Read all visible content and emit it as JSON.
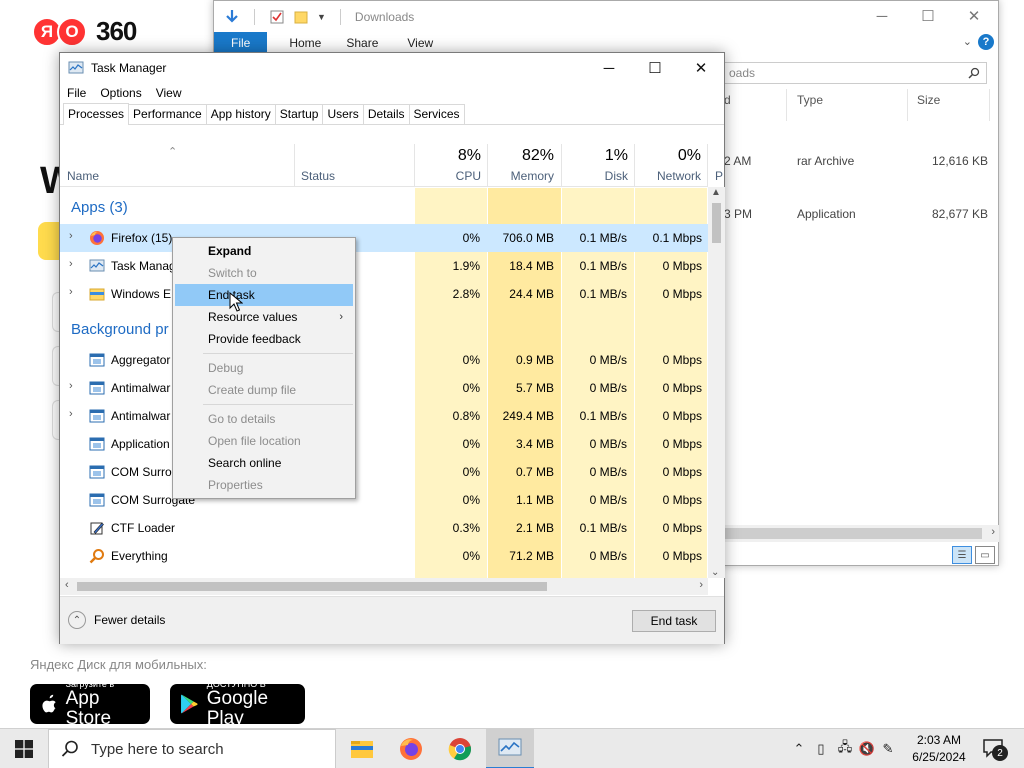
{
  "background_page": {
    "logo_letters": [
      "Я",
      "O"
    ],
    "logo_number": "360",
    "heading_fragment": "W",
    "mobile_label": "Яндекс Диск для мобильных:",
    "app_store": {
      "small": "Загрузите в",
      "big": "App Store"
    },
    "google_play": {
      "small": "ДОСТУПНО В",
      "big": "Google Play"
    }
  },
  "explorer": {
    "title": "Downloads",
    "ribbon_tabs": [
      "File",
      "Home",
      "Share",
      "View"
    ],
    "help_label": "?",
    "search_placeholder": "oads",
    "columns": [
      "d",
      "Type",
      "Size"
    ],
    "rows": [
      {
        "date": "2 AM",
        "type": "rar Archive",
        "size": "12,616 KB"
      },
      {
        "date": "3 PM",
        "type": "Application",
        "size": "82,677 KB"
      }
    ]
  },
  "task_manager": {
    "title": "Task Manager",
    "menu": [
      "File",
      "Options",
      "View"
    ],
    "tabs": [
      "Processes",
      "Performance",
      "App history",
      "Startup",
      "Users",
      "Details",
      "Services"
    ],
    "columns": {
      "name": "Name",
      "status": "Status",
      "cpu": {
        "pct": "8%",
        "label": "CPU"
      },
      "memory": {
        "pct": "82%",
        "label": "Memory"
      },
      "disk": {
        "pct": "1%",
        "label": "Disk"
      },
      "network": {
        "pct": "0%",
        "label": "Network"
      },
      "power": "P"
    },
    "groups": {
      "apps": "Apps (3)",
      "background": "Background pr"
    },
    "apps": [
      {
        "name": "Firefox (15)",
        "cpu": "0%",
        "memory": "706.0 MB",
        "disk": "0.1 MB/s",
        "network": "0.1 Mbps"
      },
      {
        "name": "Task Manag",
        "cpu": "1.9%",
        "memory": "18.4 MB",
        "disk": "0.1 MB/s",
        "network": "0 Mbps"
      },
      {
        "name": "Windows E",
        "cpu": "2.8%",
        "memory": "24.4 MB",
        "disk": "0.1 MB/s",
        "network": "0 Mbps"
      }
    ],
    "background": [
      {
        "name": "Aggregator",
        "cpu": "0%",
        "memory": "0.9 MB",
        "disk": "0 MB/s",
        "network": "0 Mbps"
      },
      {
        "name": "Antimalwar",
        "cpu": "0%",
        "memory": "5.7 MB",
        "disk": "0 MB/s",
        "network": "0 Mbps"
      },
      {
        "name": "Antimalwar",
        "cpu": "0.8%",
        "memory": "249.4 MB",
        "disk": "0.1 MB/s",
        "network": "0 Mbps"
      },
      {
        "name": "Application",
        "cpu": "0%",
        "memory": "3.4 MB",
        "disk": "0 MB/s",
        "network": "0 Mbps"
      },
      {
        "name": "COM Surro",
        "cpu": "0%",
        "memory": "0.7 MB",
        "disk": "0 MB/s",
        "network": "0 Mbps"
      },
      {
        "name": "COM Surrogate",
        "cpu": "0%",
        "memory": "1.1 MB",
        "disk": "0 MB/s",
        "network": "0 Mbps"
      },
      {
        "name": "CTF Loader",
        "cpu": "0.3%",
        "memory": "2.1 MB",
        "disk": "0.1 MB/s",
        "network": "0 Mbps"
      },
      {
        "name": "Everything",
        "cpu": "0%",
        "memory": "71.2 MB",
        "disk": "0 MB/s",
        "network": "0 Mbps"
      }
    ],
    "fewer_details": "Fewer details",
    "end_task_button": "End task"
  },
  "context_menu": {
    "items": [
      {
        "label": "Expand",
        "bold": true
      },
      {
        "label": "Switch to",
        "disabled": true
      },
      {
        "label": "End task",
        "hover": true
      },
      {
        "label": "Resource values",
        "submenu": true
      },
      {
        "label": "Provide feedback"
      },
      {
        "label": "Debug",
        "disabled": true
      },
      {
        "label": "Create dump file",
        "disabled": true
      },
      {
        "label": "Go to details",
        "disabled": true
      },
      {
        "label": "Open file location",
        "disabled": true
      },
      {
        "label": "Search online"
      },
      {
        "label": "Properties",
        "disabled": true
      }
    ]
  },
  "taskbar": {
    "search_placeholder": "Type here to search",
    "time": "2:03 AM",
    "date": "6/25/2024",
    "notification_count": "2",
    "apps": [
      "file-explorer",
      "firefox",
      "chrome",
      "task-manager"
    ]
  },
  "colors": {
    "accent": "#1979ca",
    "heat": "#fff4c4",
    "selected_row": "#cce8ff",
    "context_hover": "#91c9f7",
    "group_heading": "#1e6bc4"
  }
}
